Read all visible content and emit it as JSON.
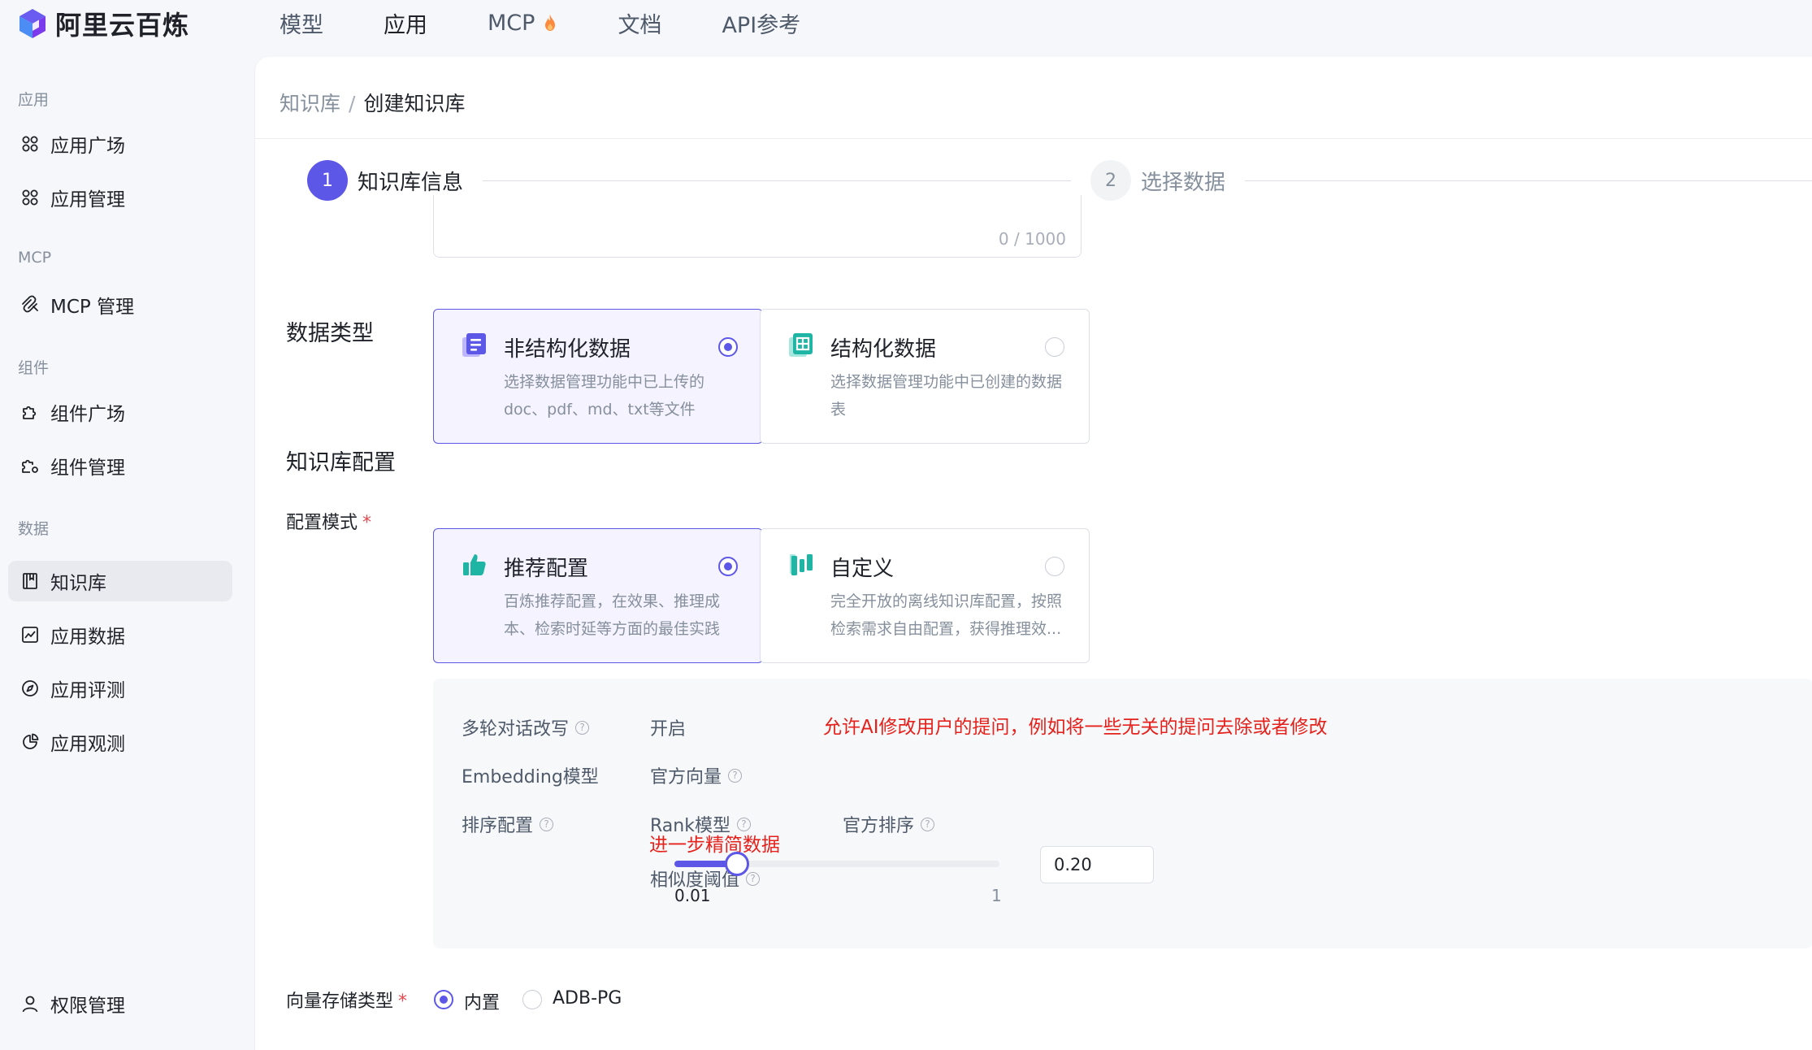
{
  "brand": {
    "name": "阿里云百炼"
  },
  "nav": {
    "items": [
      {
        "label": "模型"
      },
      {
        "label": "应用"
      },
      {
        "label": "MCP"
      },
      {
        "label": "文档"
      },
      {
        "label": "API参考"
      }
    ],
    "active": "应用"
  },
  "sidebar": {
    "groups": {
      "app": "应用",
      "mcp": "MCP",
      "component": "组件",
      "data": "数据"
    },
    "items": {
      "app_plaza": "应用广场",
      "app_manage": "应用管理",
      "mcp_manage": "MCP 管理",
      "comp_plaza": "组件广场",
      "comp_manage": "组件管理",
      "kb": "知识库",
      "app_data": "应用数据",
      "app_eval": "应用评测",
      "app_observe": "应用观测",
      "permission": "权限管理"
    },
    "active": "知识库"
  },
  "breadcrumb": {
    "root": "知识库",
    "sep": "/",
    "current": "创建知识库"
  },
  "steps": [
    {
      "num": "1",
      "label": "知识库信息",
      "state": "active"
    },
    {
      "num": "2",
      "label": "选择数据",
      "state": "pending"
    }
  ],
  "description": {
    "counter": "0 / 1000"
  },
  "data_type": {
    "title": "数据类型",
    "options": [
      {
        "title": "非结构化数据",
        "desc": "选择数据管理功能中已上传的doc、pdf、md、txt等文件",
        "selected": true
      },
      {
        "title": "结构化数据",
        "desc": "选择数据管理功能中已创建的数据表",
        "selected": false
      }
    ]
  },
  "kb_config": {
    "title": "知识库配置",
    "mode_label": "配置模式",
    "modes": [
      {
        "title": "推荐配置",
        "desc": "百炼推荐配置，在效果、推理成本、检索时延等方面的最佳实践",
        "selected": true
      },
      {
        "title": "自定义",
        "desc": "完全开放的离线知识库配置，按照检索需求自由配置，获得推理效...",
        "selected": false
      }
    ],
    "details": {
      "multi_turn_label": "多轮对话改写",
      "multi_turn_value": "开启",
      "embedding_label": "Embedding模型",
      "embedding_value": "官方向量",
      "sort_label": "排序配置",
      "rank_label": "Rank模型",
      "rank_value": "官方排序",
      "similarity_label": "相似度阈值",
      "slider_min": "0.01",
      "slider_max": "1",
      "similarity_value": "0.20",
      "similarity_fraction": 0.1919
    },
    "annotations": {
      "rewrite_note": "允许AI修改用户的提问，例如将一些无关的提问去除或者修改",
      "rank_note": "进一步精简数据"
    }
  },
  "vector_storage": {
    "label": "向量存储类型",
    "options": [
      {
        "label": "内置",
        "selected": true
      },
      {
        "label": "ADB-PG",
        "selected": false
      }
    ]
  },
  "colors": {
    "accent": "#5d57e8",
    "teal": "#1fb5a5",
    "annotation_red": "#e5211c"
  }
}
